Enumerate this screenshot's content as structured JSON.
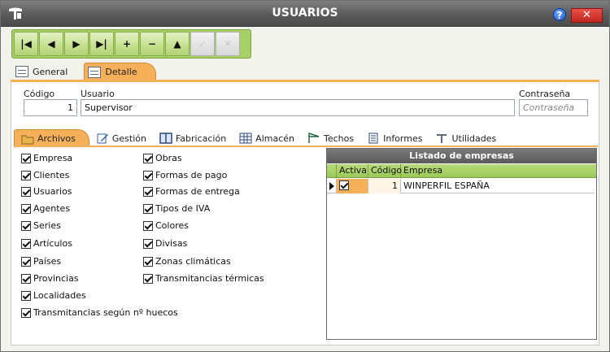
{
  "window": {
    "title": "USUARIOS",
    "help": "?",
    "close": "✕"
  },
  "toolbar": {
    "first": "|◀",
    "prev": "◀",
    "next": "▶",
    "last": "▶|",
    "add": "+",
    "delete": "−",
    "up": "▲",
    "confirm": "✓",
    "cancel": "✕"
  },
  "main_tabs": [
    {
      "label": "General"
    },
    {
      "label": "Detalle",
      "active": true
    }
  ],
  "form": {
    "codigo_label": "Código",
    "codigo_value": "1",
    "usuario_label": "Usuario",
    "usuario_value": "Supervisor",
    "password_label": "Contraseña",
    "password_placeholder": "Contraseña"
  },
  "sub_tabs": [
    {
      "label": "Archivos",
      "active": true
    },
    {
      "label": "Gestión"
    },
    {
      "label": "Fabricación"
    },
    {
      "label": "Almacén"
    },
    {
      "label": "Techos"
    },
    {
      "label": "Informes"
    },
    {
      "label": "Utilidades"
    }
  ],
  "checks_col1": [
    "Empresa",
    "Clientes",
    "Usuarios",
    "Agentes",
    "Series",
    "Artículos",
    "Países",
    "Provincias",
    "Localidades",
    "Transmitancias según nº huecos"
  ],
  "checks_col2": [
    "Obras",
    "Formas de pago",
    "Formas de entrega",
    "Tipos de IVA",
    "Colores",
    "Divisas",
    "Zonas climáticas",
    "Transmitancias térmicas"
  ],
  "grid": {
    "title": "Listado de empresas",
    "headers": [
      "Activa",
      "Código",
      "Empresa"
    ],
    "rows": [
      {
        "activa": true,
        "codigo": "1",
        "empresa": "WINPERFIL ESPAÑA"
      }
    ]
  }
}
